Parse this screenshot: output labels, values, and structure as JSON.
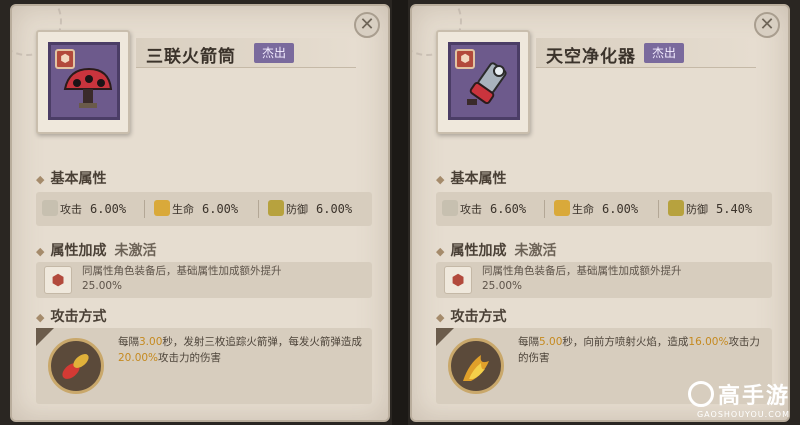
{
  "left": {
    "item_name": "三联火箭筒",
    "quality": "杰出",
    "rarity_icon": "hexagon-emblem-icon",
    "section_basic": "基本属性",
    "stats": [
      {
        "icon": "attack-icon",
        "label": "攻击",
        "value": "6.00%"
      },
      {
        "icon": "life-icon",
        "label": "生命",
        "value": "6.00%"
      },
      {
        "icon": "defense-icon",
        "label": "防御",
        "value": "6.00%"
      }
    ],
    "section_bonus": "属性加成",
    "bonus_status": "未激活",
    "bonus_line1": "同属性角色装备后，基础属性加成额外提升",
    "bonus_line2": "25.00%",
    "section_attack": "攻击方式",
    "attack_pre": "每隔",
    "attack_interval": "3.00",
    "attack_mid": "秒，发射三枚追踪火箭弹，每发火箭弹造成",
    "attack_pct": "20.00%",
    "attack_post": "攻击力的伤害"
  },
  "right": {
    "item_name": "天空净化器",
    "quality": "杰出",
    "rarity_icon": "hexagon-emblem-icon",
    "section_basic": "基本属性",
    "stats": [
      {
        "icon": "attack-icon",
        "label": "攻击",
        "value": "6.60%"
      },
      {
        "icon": "life-icon",
        "label": "生命",
        "value": "6.00%"
      },
      {
        "icon": "defense-icon",
        "label": "防御",
        "value": "5.40%"
      }
    ],
    "section_bonus": "属性加成",
    "bonus_status": "未激活",
    "bonus_line1": "同属性角色装备后，基础属性加成额外提升",
    "bonus_line2": "25.00%",
    "section_attack": "攻击方式",
    "attack_pre": "每隔",
    "attack_interval": "5.00",
    "attack_mid": "秒，向前方喷射火焰，造成",
    "attack_pct": "16.00%",
    "attack_post": "攻击力的伤害"
  },
  "close_label": "✕",
  "watermark": {
    "name": "高手游",
    "url": "GAOSHOUYOU.COM"
  },
  "colors": {
    "highlight": "#c58a20",
    "quality_bg": "#7a6a9d",
    "rarity": "#b24a3c"
  }
}
